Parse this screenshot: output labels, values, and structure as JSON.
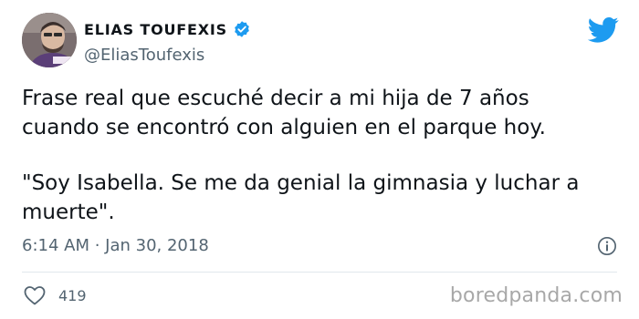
{
  "author": {
    "display_name": "ELIAS TOUFEXIS",
    "handle": "@EliasToufexis",
    "verified": true,
    "avatar_icon": "profile-photo"
  },
  "tweet": {
    "paragraphs": [
      "Frase real que escuché decir a mi hija de 7 años cuando se encontró con alguien en el parque hoy.",
      "\"Soy Isabella. Se me da genial la gimnasia y luchar a muerte\"."
    ],
    "timestamp": "6:14 AM · Jan 30, 2018"
  },
  "engagement": {
    "likes": "419"
  },
  "watermark": "boredpanda.com",
  "icons": {
    "brand": "twitter-bird-icon",
    "verified": "verified-badge-icon",
    "info": "info-icon",
    "like": "heart-icon"
  },
  "colors": {
    "twitter_blue": "#1d9bf0",
    "secondary_text": "#536471",
    "primary_text": "#0f1419"
  }
}
